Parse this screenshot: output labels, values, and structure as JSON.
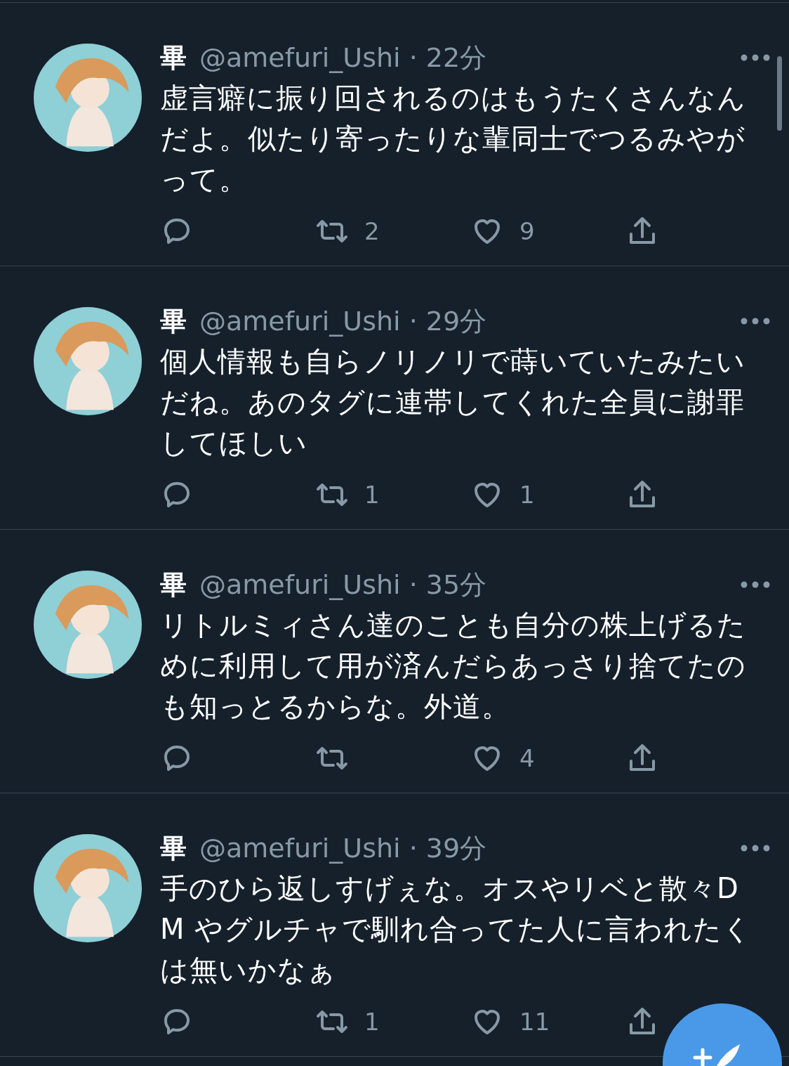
{
  "tweets": [
    {
      "name": "畢",
      "meta": "@amefuri_Ushi · 22分",
      "text": "虚言癖に振り回されるのはもうたくさんなんだよ。似たり寄ったりな輩同士でつるみやがって。",
      "retweets": "2",
      "likes": "9"
    },
    {
      "name": "畢",
      "meta": "@amefuri_Ushi · 29分",
      "text": "個人情報も自らノリノリで蒔いていたみたいだね。あのタグに連帯してくれた全員に謝罪してほしい",
      "retweets": "1",
      "likes": "1"
    },
    {
      "name": "畢",
      "meta": "@amefuri_Ushi · 35分",
      "text": "リトルミィさん達のことも自分の株上げるために利用して用が済んだらあっさり捨てたのも知っとるからな。外道。",
      "likes": "4"
    },
    {
      "name": "畢",
      "meta": "@amefuri_Ushi · 39分",
      "text": "手のひら返しすげぇな。オスやリベと散々DM やグルチャで馴れ合ってた人に言われたくは無いかなぁ",
      "retweets": "1",
      "likes": "11"
    }
  ]
}
